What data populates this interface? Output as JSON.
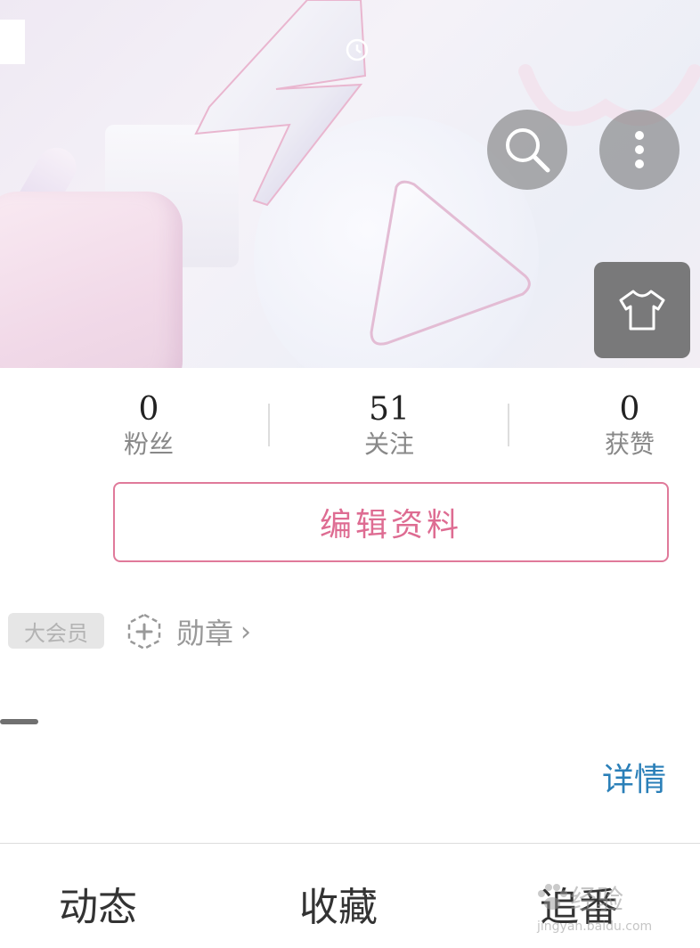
{
  "header": {
    "buttons": {
      "search_icon": "search-icon",
      "more_icon": "more-vertical-icon",
      "skin_icon": "tshirt-icon"
    }
  },
  "stats": {
    "fans": {
      "value": "0",
      "label": "粉丝"
    },
    "following": {
      "value": "51",
      "label": "关注"
    },
    "likes": {
      "value": "0",
      "label": "获赞"
    }
  },
  "profile": {
    "edit_button": "编辑资料",
    "vip_badge": "大会员",
    "medal_label": "勋章",
    "medal_chevron": "›",
    "detail_link": "详情"
  },
  "tabs": [
    {
      "label": "动态"
    },
    {
      "label": "收藏"
    },
    {
      "label": "追番"
    }
  ],
  "watermark": {
    "text": "经验",
    "url": "jingyan.baidu.com"
  },
  "colors": {
    "accent_pink": "#de6c92",
    "link_blue": "#2a7fb8",
    "overlay_grey": "#6e6e6e"
  }
}
